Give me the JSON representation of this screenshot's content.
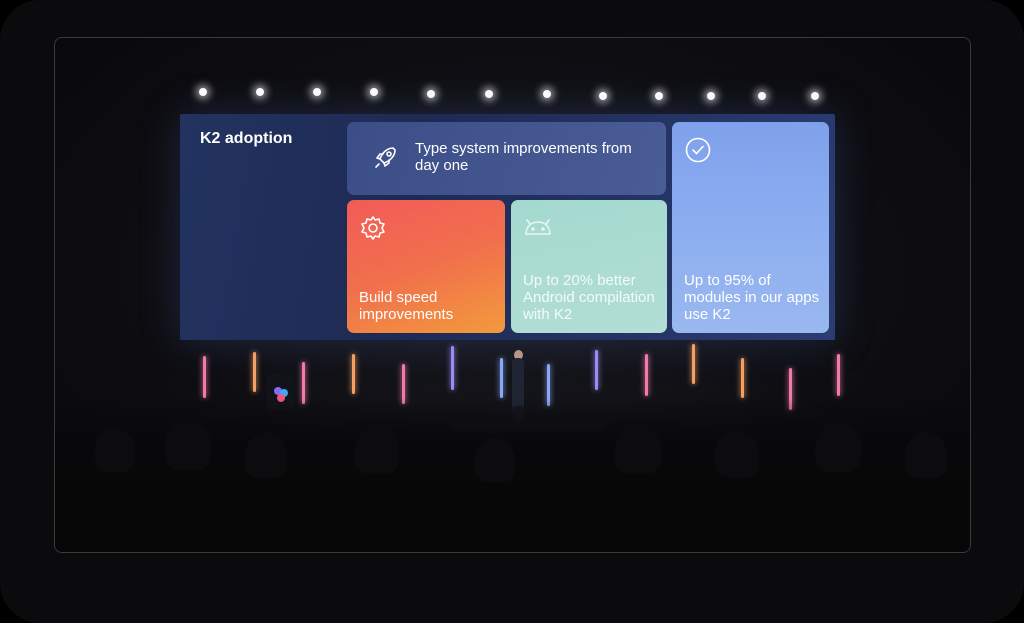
{
  "slide": {
    "title": "K2 adoption",
    "cards": {
      "type_system": "Type system improvements from day one",
      "build_speed": "Build speed improvements",
      "android": "Up to 20% better Android compilation with K2",
      "modules": "Up to 95% of modules in our apps use K2"
    },
    "icons": {
      "type_system": "rocket-icon",
      "build_speed": "gear-icon",
      "android": "android-icon",
      "modules": "checkmark-circle-icon"
    }
  },
  "colors": {
    "screen_bg": "#1d2a54",
    "card_type": "#3b4e88",
    "card_build": "#f1704c",
    "card_android": "#a4d9cf",
    "card_modules": "#8fb0f0"
  }
}
